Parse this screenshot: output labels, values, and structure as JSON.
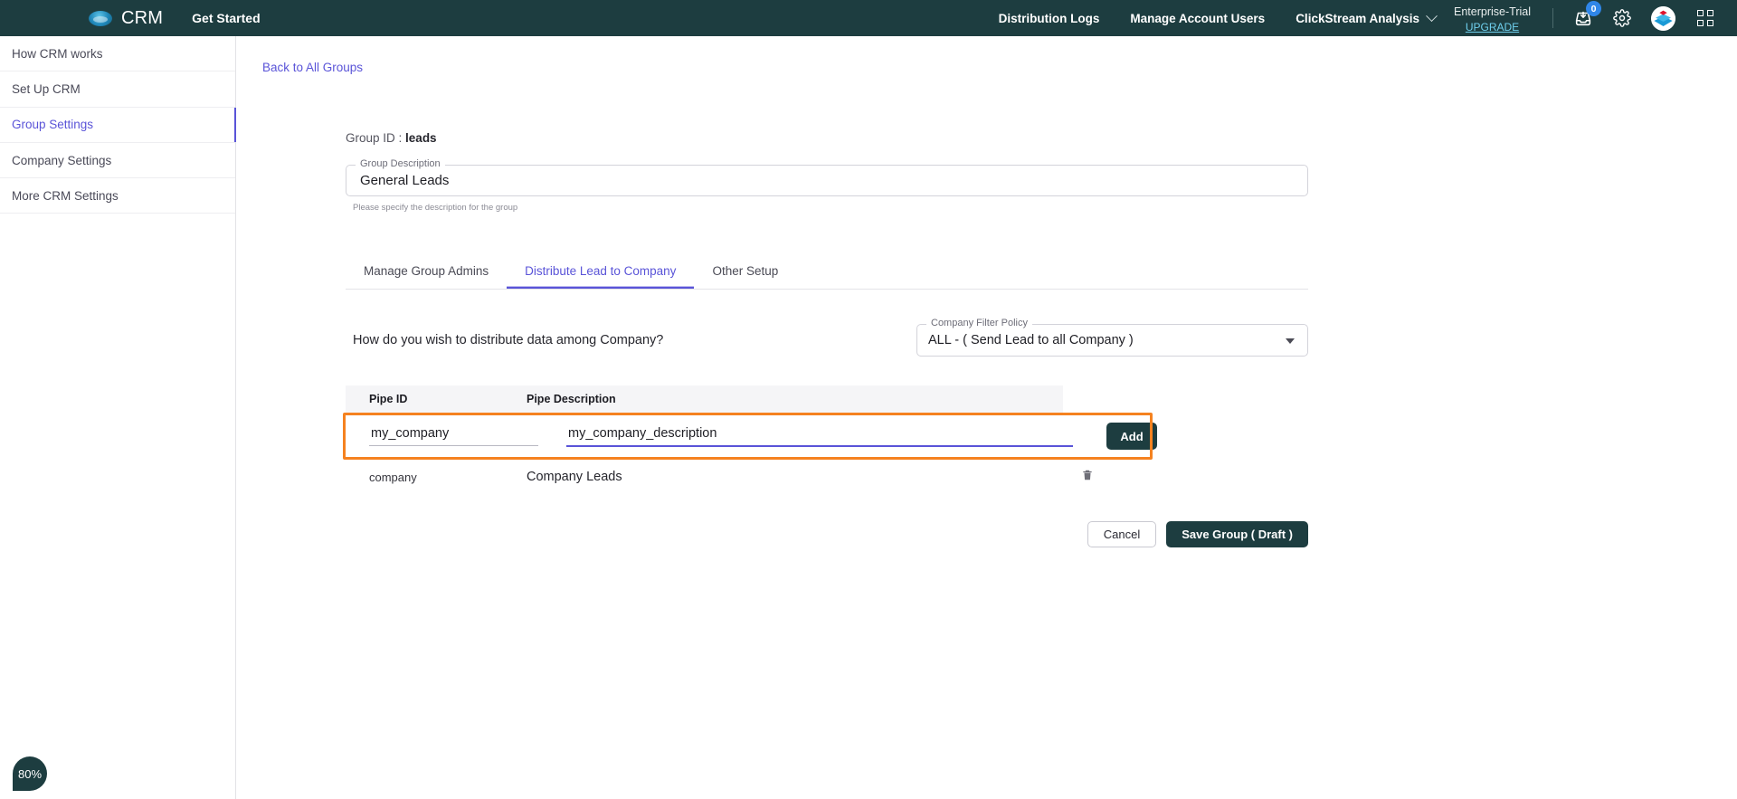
{
  "topbar": {
    "logo_icon": "cloud-logo-icon",
    "brand": "CRM",
    "get_started": "Get Started",
    "nav": [
      {
        "label": "Distribution Logs",
        "icon": null
      },
      {
        "label": "Manage Account Users",
        "icon": null
      },
      {
        "label": "ClickStream Analysis",
        "icon": "chevron-down-icon"
      }
    ],
    "plan_name": "Enterprise-Trial",
    "plan_upgrade": "UPGRADE",
    "inbox_icon": "inbox-download-icon",
    "inbox_badge": "0",
    "gear_icon": "gear-icon",
    "avatar_icon": "app-logo-avatar-icon",
    "apps_icon": "apps-grid-icon",
    "bg_color": "#1d3d40"
  },
  "sidebar": {
    "items": [
      {
        "label": "How CRM works",
        "active": false
      },
      {
        "label": "Set Up CRM",
        "active": false
      },
      {
        "label": "Group Settings",
        "active": true
      },
      {
        "label": "Company Settings",
        "active": false
      },
      {
        "label": "More CRM Settings",
        "active": false
      }
    ],
    "active_color": "#5a54d8"
  },
  "main": {
    "back_link": "Back to All Groups",
    "group_id_label": "Group ID :",
    "group_id_value": "leads",
    "description_field": {
      "label": "Group Description",
      "value": "General Leads",
      "help": "Please specify the description for the group"
    },
    "tabs": [
      {
        "label": "Manage Group Admins",
        "active": false
      },
      {
        "label": "Distribute Lead to Company",
        "active": true
      },
      {
        "label": "Other Setup",
        "active": false
      }
    ],
    "distribute_question": "How do you wish to distribute data among Company?",
    "filter_policy": {
      "label": "Company Filter Policy",
      "value": "ALL - ( Send Lead to all Company )",
      "arrow_icon": "dropdown-arrow-icon"
    },
    "table": {
      "columns": [
        "Pipe ID",
        "Pipe Description"
      ],
      "new_row": {
        "pipe_id": "my_company",
        "pipe_description": "my_company_description",
        "add_label": "Add"
      },
      "rows": [
        {
          "pipe_id": "company",
          "pipe_description": "Company Leads",
          "delete_icon": "trash-icon"
        }
      ],
      "highlight_color": "#f58220"
    },
    "actions": {
      "cancel": "Cancel",
      "save": "Save Group ( Draft )"
    }
  },
  "zoom_badge": {
    "value": "80%"
  }
}
